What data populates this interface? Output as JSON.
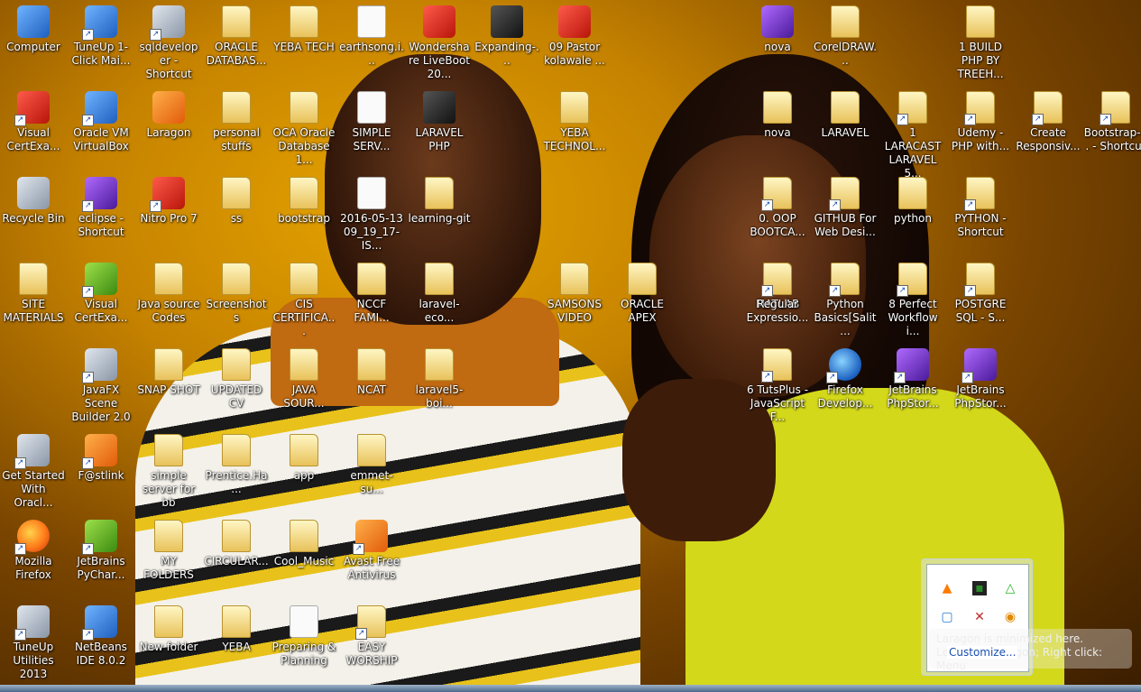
{
  "desktop": {
    "icons": [
      {
        "label": "Computer",
        "kind": "app",
        "name": "computer-icon"
      },
      {
        "label": "TuneUp 1-Click Mai...",
        "kind": "app",
        "name": "tuneup-icon",
        "shortcut": true
      },
      {
        "label": "sqldeveloper - Shortcut",
        "kind": "gray",
        "name": "sqldeveloper-icon",
        "shortcut": true
      },
      {
        "label": "ORACLE DATABAS...",
        "kind": "folder",
        "name": "folder-icon"
      },
      {
        "label": "YEBA TECH",
        "kind": "folder",
        "name": "folder-icon"
      },
      {
        "label": "earthsong.i...",
        "kind": "doc",
        "name": "document-icon"
      },
      {
        "label": "Wondershare LiveBoot 20...",
        "kind": "red",
        "name": "liveboot-icon"
      },
      {
        "label": "Expanding-...",
        "kind": "dark",
        "name": "video-file-icon"
      },
      {
        "label": "09 Pastor kolawale ...",
        "kind": "red",
        "name": "mp3-icon"
      },
      {
        "label": "nova",
        "kind": "purple",
        "name": "archive-icon"
      },
      {
        "label": "CorelDRAW...",
        "kind": "folder",
        "name": "folder-icon"
      },
      {
        "label": "1 BUILD PHP BY TREEH...",
        "kind": "folder",
        "name": "folder-icon"
      },
      {
        "label": "Visual CertExa...",
        "kind": "red",
        "name": "visual-certexam-icon",
        "shortcut": true
      },
      {
        "label": "Oracle VM VirtualBox",
        "kind": "app",
        "name": "virtualbox-icon",
        "shortcut": true
      },
      {
        "label": "Laragon",
        "kind": "orange",
        "name": "laragon-icon"
      },
      {
        "label": "personal stuffs",
        "kind": "folder",
        "name": "folder-icon"
      },
      {
        "label": "OCA Oracle Database 1...",
        "kind": "folder",
        "name": "folder-icon"
      },
      {
        "label": "SIMPLE SERV...",
        "kind": "doc",
        "name": "document-icon"
      },
      {
        "label": "LARAVEL PHP",
        "kind": "dark",
        "name": "document-icon"
      },
      {
        "label": "YEBA TECHNOL...",
        "kind": "folder",
        "name": "folder-icon"
      },
      {
        "label": "nova",
        "kind": "folder",
        "name": "folder-icon"
      },
      {
        "label": "LARAVEL",
        "kind": "folder",
        "name": "folder-icon"
      },
      {
        "label": "1 LARACAST LARAVEL 5...",
        "kind": "folder",
        "name": "folder-icon",
        "shortcut": true
      },
      {
        "label": "Udemy - PHP with...",
        "kind": "folder",
        "name": "folder-icon",
        "shortcut": true
      },
      {
        "label": "Create Responsiv...",
        "kind": "folder",
        "name": "folder-icon",
        "shortcut": true
      },
      {
        "label": "Bootstrap-... - Shortcut",
        "kind": "folder",
        "name": "folder-icon",
        "shortcut": true
      },
      {
        "label": "Recycle Bin",
        "kind": "gray",
        "name": "recycle-bin-icon"
      },
      {
        "label": "eclipse - Shortcut",
        "kind": "purple",
        "name": "eclipse-icon",
        "shortcut": true
      },
      {
        "label": "Nitro Pro 7",
        "kind": "red",
        "name": "nitro-icon",
        "shortcut": true
      },
      {
        "label": "ss",
        "kind": "folder",
        "name": "folder-icon"
      },
      {
        "label": "bootstrap",
        "kind": "folder",
        "name": "folder-icon"
      },
      {
        "label": "2016-05-13 09_19_17-IS...",
        "kind": "doc",
        "name": "document-icon"
      },
      {
        "label": "learning-git",
        "kind": "folder",
        "name": "folder-icon"
      },
      {
        "label": "0. OOP BOOTCA...",
        "kind": "folder",
        "name": "folder-icon",
        "shortcut": true
      },
      {
        "label": "GITHUB For Web Desi...",
        "kind": "folder",
        "name": "folder-icon",
        "shortcut": true
      },
      {
        "label": "python",
        "kind": "folder",
        "name": "folder-icon"
      },
      {
        "label": "PYTHON - Shortcut",
        "kind": "folder",
        "name": "folder-icon",
        "shortcut": true
      },
      {
        "label": "SITE MATERIALS",
        "kind": "folder",
        "name": "folder-icon"
      },
      {
        "label": "Visual CertExa...",
        "kind": "green",
        "name": "visual-certexam-icon",
        "shortcut": true
      },
      {
        "label": "Java source Codes",
        "kind": "folder",
        "name": "folder-icon"
      },
      {
        "label": "Screenshots",
        "kind": "folder",
        "name": "folder-icon"
      },
      {
        "label": "CIS CERTIFICA...",
        "kind": "folder",
        "name": "folder-icon"
      },
      {
        "label": "NCCF FAMI...",
        "kind": "folder",
        "name": "folder-icon"
      },
      {
        "label": "laravel-eco...",
        "kind": "folder",
        "name": "folder-icon"
      },
      {
        "label": "SAMSONS VIDEO",
        "kind": "folder",
        "name": "folder-icon"
      },
      {
        "label": "MATLAB",
        "kind": "folder",
        "name": "folder-icon"
      },
      {
        "label": "ORACLE APEX",
        "kind": "folder",
        "name": "folder-icon"
      },
      {
        "label": "Regular Expressio...",
        "kind": "folder",
        "name": "folder-icon",
        "shortcut": true
      },
      {
        "label": "Python Basics[Salit...",
        "kind": "folder",
        "name": "folder-icon",
        "shortcut": true
      },
      {
        "label": "8 Perfect Workflow i...",
        "kind": "folder",
        "name": "folder-icon",
        "shortcut": true
      },
      {
        "label": "POSTGRE SQL - S...",
        "kind": "folder",
        "name": "folder-icon",
        "shortcut": true
      },
      {
        "label": "JavaFX Scene Builder 2.0",
        "kind": "gray",
        "name": "javafx-icon",
        "shortcut": true
      },
      {
        "label": "SNAP SHOT",
        "kind": "folder",
        "name": "folder-icon"
      },
      {
        "label": "UPDATED CV",
        "kind": "folder",
        "name": "folder-icon"
      },
      {
        "label": "JAVA SOUR...",
        "kind": "folder",
        "name": "folder-icon"
      },
      {
        "label": "NCAT",
        "kind": "folder",
        "name": "folder-icon"
      },
      {
        "label": "laravel5-boi...",
        "kind": "folder",
        "name": "folder-icon"
      },
      {
        "label": "6 TutsPlus - JavaScript F...",
        "kind": "folder",
        "name": "folder-icon",
        "shortcut": true
      },
      {
        "label": "Firefox Develop...",
        "kind": "blue",
        "name": "firefox-developer-icon",
        "shortcut": true
      },
      {
        "label": "JetBrains PhpStor...",
        "kind": "purple",
        "name": "phpstorm-icon",
        "shortcut": true
      },
      {
        "label": "JetBrains PhpStor...",
        "kind": "purple",
        "name": "phpstorm-icon",
        "shortcut": true
      },
      {
        "label": "Get Started With Oracl...",
        "kind": "gray",
        "name": "oracle-db-icon",
        "shortcut": true
      },
      {
        "label": "F@stlink",
        "kind": "orange",
        "name": "fastlink-icon",
        "shortcut": true
      },
      {
        "label": "simple server for bb",
        "kind": "folder",
        "name": "folder-icon"
      },
      {
        "label": "Prentice.Ha...",
        "kind": "folder",
        "name": "folder-icon"
      },
      {
        "label": "app",
        "kind": "folder",
        "name": "folder-icon"
      },
      {
        "label": "emmet-su...",
        "kind": "folder",
        "name": "folder-icon"
      },
      {
        "label": "Mozilla Firefox",
        "kind": "firefox",
        "name": "firefox-icon",
        "shortcut": true
      },
      {
        "label": "JetBrains PyChar...",
        "kind": "green",
        "name": "pycharm-icon",
        "shortcut": true
      },
      {
        "label": "MY FOLDERS",
        "kind": "folder",
        "name": "folder-icon"
      },
      {
        "label": "CIRCULAR...",
        "kind": "folder",
        "name": "folder-icon"
      },
      {
        "label": "Cool_Music",
        "kind": "folder",
        "name": "folder-icon"
      },
      {
        "label": "Avast Free Antivirus",
        "kind": "orange",
        "name": "avast-icon",
        "shortcut": true
      },
      {
        "label": "TuneUp Utilities 2013",
        "kind": "gray",
        "name": "tuneup-utilities-icon",
        "shortcut": true
      },
      {
        "label": "NetBeans IDE 8.0.2",
        "kind": "app",
        "name": "netbeans-icon",
        "shortcut": true
      },
      {
        "label": "New folder",
        "kind": "folder",
        "name": "folder-icon"
      },
      {
        "label": "YEBA",
        "kind": "folder",
        "name": "folder-icon"
      },
      {
        "label": "Preparing & Planning",
        "kind": "doc",
        "name": "document-icon"
      },
      {
        "label": "EASY WORSHIP",
        "kind": "folder",
        "name": "folder-icon",
        "shortcut": true
      }
    ]
  },
  "tray_popup": {
    "customize_label": "Customize...",
    "icons": [
      "vlc-icon",
      "terminal-icon",
      "drive-icon",
      "laragon-tray-icon",
      "network-icon",
      "avast-tray-icon"
    ]
  },
  "tooltip": {
    "line1": "Laragon is minimized here.",
    "line2": "Left click: Laragon; Right click: Menu"
  }
}
